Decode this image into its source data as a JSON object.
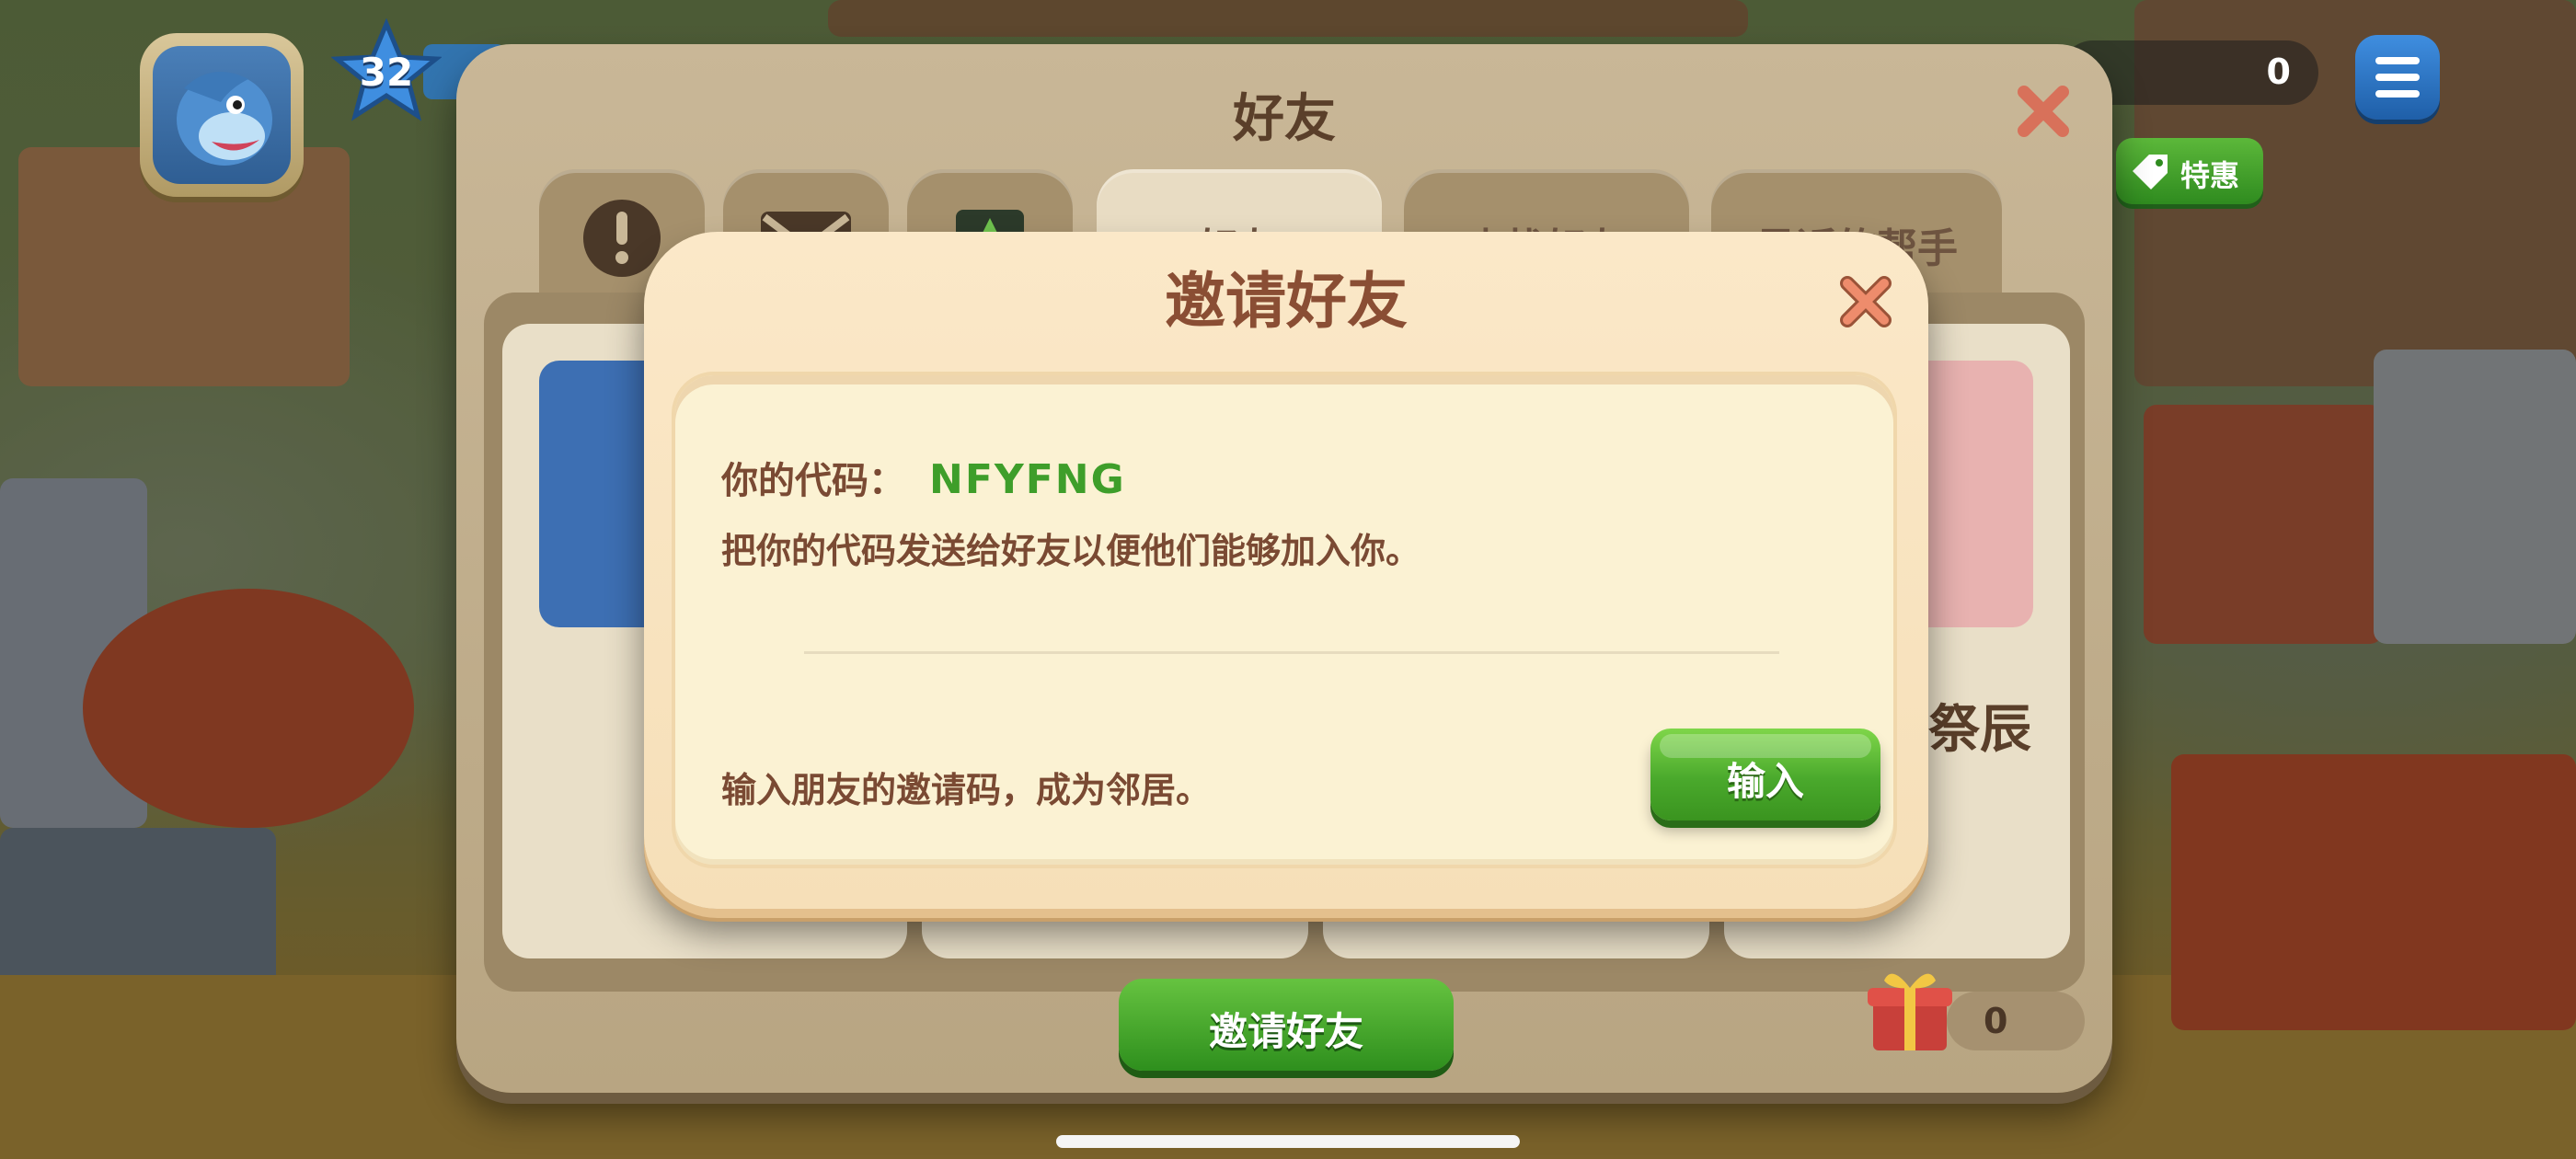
{
  "hud": {
    "level": "32",
    "coins": "0",
    "deal_label": "特惠"
  },
  "friends_panel": {
    "title": "好友",
    "tabs": [
      {
        "label": ""
      },
      {
        "label": ""
      },
      {
        "label": ""
      },
      {
        "label": "好友"
      },
      {
        "label": "查找好友"
      },
      {
        "label": "最近的帮手"
      }
    ],
    "friend_name": "祭辰",
    "invite_button": "邀请好友",
    "gift_count": "0"
  },
  "invite_dialog": {
    "title": "邀请好友",
    "code_label": "你的代码：",
    "code_value": "NFYFNG",
    "send_hint": "把你的代码发送给好友以便他们能够加入你。",
    "enter_hint": "输入朋友的邀请码，成为邻居。",
    "enter_button": "输入"
  },
  "colors": {
    "dialog_bg": "#fbe8c8",
    "dialog_title": "#8a4e34",
    "code_green": "#3e9e2a",
    "button_green": "#4aa92c",
    "close_red": "#e07a5a"
  }
}
